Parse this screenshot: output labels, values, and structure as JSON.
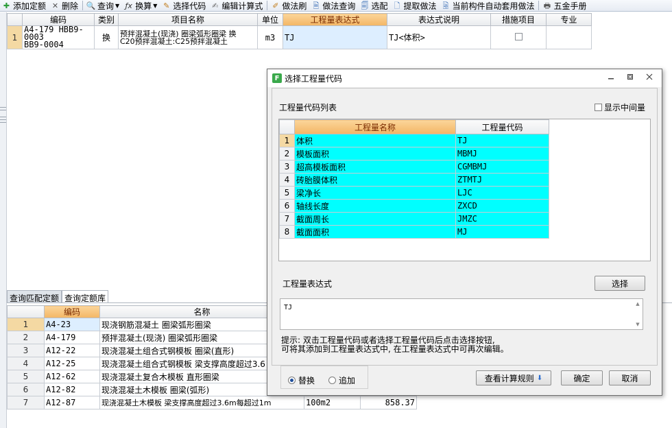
{
  "toolbar": {
    "items": [
      {
        "label": "添加定额",
        "icon": "add-icon",
        "glyph": "✚"
      },
      {
        "label": "删除",
        "icon": "delete-icon",
        "glyph": "✕"
      },
      {
        "label": "查询",
        "icon": "search-icon",
        "glyph": "🔍"
      },
      {
        "label": "换算",
        "icon": "formula-icon",
        "glyph": "ƒx"
      },
      {
        "label": "选择代码",
        "icon": "select-code-icon",
        "glyph": "✎"
      },
      {
        "label": "编辑计算式",
        "icon": "edit-formula-icon",
        "glyph": "✍"
      },
      {
        "label": "做法刷",
        "icon": "brush-icon",
        "glyph": "✐"
      },
      {
        "label": "做法查询",
        "icon": "method-query-icon",
        "glyph": "🗎"
      },
      {
        "label": "选配",
        "icon": "match-icon",
        "glyph": "🗐"
      },
      {
        "label": "提取做法",
        "icon": "extract-icon",
        "glyph": "🗋"
      },
      {
        "label": "当前构件自动套用做法",
        "icon": "auto-apply-icon",
        "glyph": "🗟"
      },
      {
        "label": "五金手册",
        "icon": "manual-icon",
        "glyph": "🖶"
      }
    ]
  },
  "top_grid": {
    "headers": [
      "",
      "编码",
      "类别",
      "项目名称",
      "单位",
      "工程量表达式",
      "表达式说明",
      "措施项目",
      "专业"
    ],
    "rows": [
      {
        "num": "1",
        "code_line1": "A4-179 HBB9-0003",
        "code_line2": "BB9-0004",
        "type": "换",
        "name_line1": "预拌混凝土(现浇) 圈梁弧形圈梁 换",
        "name_line2": "C20预拌混凝土:C25预拌混凝土",
        "unit": "m3",
        "expr": "TJ",
        "expr_desc": "TJ<体积>"
      }
    ]
  },
  "bottom": {
    "tabs": [
      "查询匹配定额",
      "查询定额库"
    ],
    "headers": [
      "",
      "编码",
      "名称"
    ],
    "rows": [
      {
        "num": "1",
        "code": "A4-23",
        "name": "现浇钢筋混凝土 圈梁弧形圈梁",
        "unit": "",
        "price": ""
      },
      {
        "num": "2",
        "code": "A4-179",
        "name": "预拌混凝土(现浇) 圈梁弧形圈梁",
        "unit": "",
        "price": ""
      },
      {
        "num": "3",
        "code": "A12-22",
        "name": "现浇混凝土组合式钢模板 圈梁(直形)",
        "unit": "",
        "price": ""
      },
      {
        "num": "4",
        "code": "A12-25",
        "name": "现浇混凝土组合式钢模板 梁支撑高度超过3.6",
        "unit": "",
        "price": ""
      },
      {
        "num": "5",
        "code": "A12-62",
        "name": "现浇混凝土复合木模板 直形圈梁",
        "unit": "",
        "price": ""
      },
      {
        "num": "6",
        "code": "A12-82",
        "name": "现浇混凝土木模板 圈梁(弧形)",
        "unit": "",
        "price": ""
      },
      {
        "num": "7",
        "code": "A12-87",
        "name": "现浇混凝土木模板 梁支撑高度超过3.6m每超过1m",
        "unit": "100m2",
        "price": "858.37"
      }
    ]
  },
  "dialog": {
    "title": "选择工程量代码",
    "app_icon_letter": "F",
    "list_label": "工程量代码列表",
    "show_intermediate_label": "显示中间量",
    "table_headers": [
      "",
      "工程量名称",
      "工程量代码"
    ],
    "items": [
      {
        "num": "1",
        "name": "体积",
        "code": "TJ"
      },
      {
        "num": "2",
        "name": "模板面积",
        "code": "MBMJ"
      },
      {
        "num": "3",
        "name": "超高模板面积",
        "code": "CGMBMJ"
      },
      {
        "num": "4",
        "name": "砖胎膜体积",
        "code": "ZTMTJ"
      },
      {
        "num": "5",
        "name": "梁净长",
        "code": "LJC"
      },
      {
        "num": "6",
        "name": "轴线长度",
        "code": "ZXCD"
      },
      {
        "num": "7",
        "name": "截面周长",
        "code": "JMZC"
      },
      {
        "num": "8",
        "name": "截面面积",
        "code": "MJ"
      }
    ],
    "expr_label": "工程量表达式",
    "select_button": "选择",
    "expr_value": "TJ",
    "hint_line1": "提示: 双击工程量代码或者选择工程量代码后点击选择按钮,",
    "hint_line2": "可将其添加到工程量表达式中, 在工程量表达式中可再次编辑。",
    "radio_replace": "替换",
    "radio_append": "追加",
    "view_rules_button": "查看计算规则",
    "ok_button": "确定",
    "cancel_button": "取消"
  }
}
